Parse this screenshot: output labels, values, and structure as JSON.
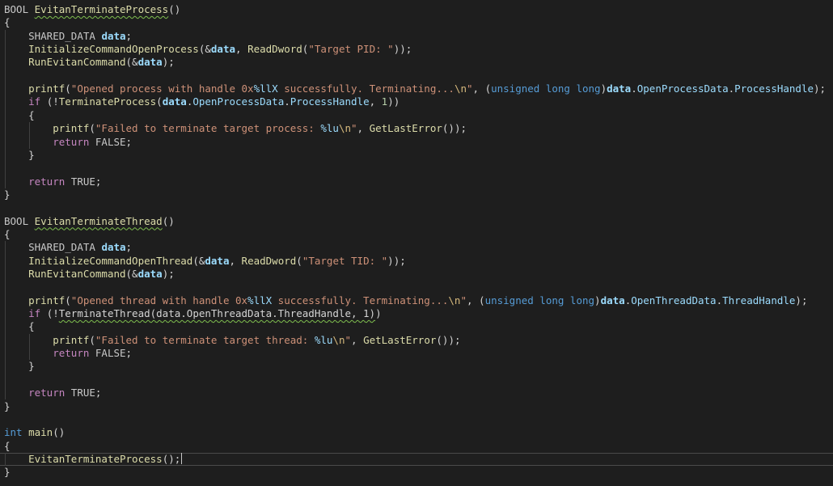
{
  "editor": {
    "lines": [
      [
        {
          "t": "BOOL",
          "c": "mac"
        },
        {
          "t": " ",
          "c": "plain"
        },
        {
          "t": "EvitanTerminateProcess",
          "c": "fn sq"
        },
        {
          "t": "()",
          "c": "plain"
        }
      ],
      [
        {
          "t": "{",
          "c": "plain"
        }
      ],
      [
        {
          "t": "    ",
          "c": "plain"
        },
        {
          "t": "SHARED_DATA",
          "c": "mac"
        },
        {
          "t": " ",
          "c": "plain"
        },
        {
          "t": "data",
          "c": "var strong"
        },
        {
          "t": ";",
          "c": "plain"
        }
      ],
      [
        {
          "t": "    ",
          "c": "plain"
        },
        {
          "t": "InitializeCommandOpenProcess",
          "c": "fn"
        },
        {
          "t": "(&",
          "c": "plain"
        },
        {
          "t": "data",
          "c": "var strong"
        },
        {
          "t": ", ",
          "c": "plain"
        },
        {
          "t": "ReadDword",
          "c": "fn"
        },
        {
          "t": "(",
          "c": "plain"
        },
        {
          "t": "\"Target PID: \"",
          "c": "str"
        },
        {
          "t": "));",
          "c": "plain"
        }
      ],
      [
        {
          "t": "    ",
          "c": "plain"
        },
        {
          "t": "RunEvitanCommand",
          "c": "fn"
        },
        {
          "t": "(&",
          "c": "plain"
        },
        {
          "t": "data",
          "c": "var strong"
        },
        {
          "t": ");",
          "c": "plain"
        }
      ],
      [],
      [
        {
          "t": "    ",
          "c": "plain"
        },
        {
          "t": "printf",
          "c": "fn"
        },
        {
          "t": "(",
          "c": "plain"
        },
        {
          "t": "\"Opened process with handle 0x",
          "c": "str"
        },
        {
          "t": "%llX",
          "c": "fmt"
        },
        {
          "t": " successfully. Terminating...",
          "c": "str"
        },
        {
          "t": "\\n",
          "c": "esc"
        },
        {
          "t": "\"",
          "c": "str"
        },
        {
          "t": ", (",
          "c": "plain"
        },
        {
          "t": "unsigned long long",
          "c": "kw"
        },
        {
          "t": ")",
          "c": "plain"
        },
        {
          "t": "data",
          "c": "var strong"
        },
        {
          "t": ".",
          "c": "plain"
        },
        {
          "t": "OpenProcessData",
          "c": "var"
        },
        {
          "t": ".",
          "c": "plain"
        },
        {
          "t": "ProcessHandle",
          "c": "var"
        },
        {
          "t": ");",
          "c": "plain"
        }
      ],
      [
        {
          "t": "    ",
          "c": "plain"
        },
        {
          "t": "if",
          "c": "ctl"
        },
        {
          "t": " (!",
          "c": "plain"
        },
        {
          "t": "TerminateProcess",
          "c": "fn"
        },
        {
          "t": "(",
          "c": "plain"
        },
        {
          "t": "data",
          "c": "var strong"
        },
        {
          "t": ".",
          "c": "plain"
        },
        {
          "t": "OpenProcessData",
          "c": "var"
        },
        {
          "t": ".",
          "c": "plain"
        },
        {
          "t": "ProcessHandle",
          "c": "var"
        },
        {
          "t": ", ",
          "c": "plain"
        },
        {
          "t": "1",
          "c": "num"
        },
        {
          "t": "))",
          "c": "plain"
        }
      ],
      [
        {
          "t": "    {",
          "c": "plain"
        }
      ],
      [
        {
          "t": "        ",
          "c": "plain"
        },
        {
          "t": "printf",
          "c": "fn"
        },
        {
          "t": "(",
          "c": "plain"
        },
        {
          "t": "\"Failed to terminate target process: ",
          "c": "str"
        },
        {
          "t": "%lu",
          "c": "fmt"
        },
        {
          "t": "\\n",
          "c": "esc"
        },
        {
          "t": "\"",
          "c": "str"
        },
        {
          "t": ", ",
          "c": "plain"
        },
        {
          "t": "GetLastError",
          "c": "fn"
        },
        {
          "t": "());",
          "c": "plain"
        }
      ],
      [
        {
          "t": "        ",
          "c": "plain"
        },
        {
          "t": "return",
          "c": "ctl"
        },
        {
          "t": " ",
          "c": "plain"
        },
        {
          "t": "FALSE",
          "c": "mac"
        },
        {
          "t": ";",
          "c": "plain"
        }
      ],
      [
        {
          "t": "    }",
          "c": "plain"
        }
      ],
      [],
      [
        {
          "t": "    ",
          "c": "plain"
        },
        {
          "t": "return",
          "c": "ctl"
        },
        {
          "t": " ",
          "c": "plain"
        },
        {
          "t": "TRUE",
          "c": "mac"
        },
        {
          "t": ";",
          "c": "plain"
        }
      ],
      [
        {
          "t": "}",
          "c": "plain"
        }
      ],
      [],
      [
        {
          "t": "BOOL",
          "c": "mac"
        },
        {
          "t": " ",
          "c": "plain"
        },
        {
          "t": "EvitanTerminateThread",
          "c": "fn sq"
        },
        {
          "t": "()",
          "c": "plain"
        }
      ],
      [
        {
          "t": "{",
          "c": "plain"
        }
      ],
      [
        {
          "t": "    ",
          "c": "plain"
        },
        {
          "t": "SHARED_DATA",
          "c": "mac"
        },
        {
          "t": " ",
          "c": "plain"
        },
        {
          "t": "data",
          "c": "var strong"
        },
        {
          "t": ";",
          "c": "plain"
        }
      ],
      [
        {
          "t": "    ",
          "c": "plain"
        },
        {
          "t": "InitializeCommandOpenThread",
          "c": "fn"
        },
        {
          "t": "(&",
          "c": "plain"
        },
        {
          "t": "data",
          "c": "var strong"
        },
        {
          "t": ", ",
          "c": "plain"
        },
        {
          "t": "ReadDword",
          "c": "fn"
        },
        {
          "t": "(",
          "c": "plain"
        },
        {
          "t": "\"Target TID: \"",
          "c": "str"
        },
        {
          "t": "));",
          "c": "plain"
        }
      ],
      [
        {
          "t": "    ",
          "c": "plain"
        },
        {
          "t": "RunEvitanCommand",
          "c": "fn"
        },
        {
          "t": "(&",
          "c": "plain"
        },
        {
          "t": "data",
          "c": "var strong"
        },
        {
          "t": ");",
          "c": "plain"
        }
      ],
      [],
      [
        {
          "t": "    ",
          "c": "plain"
        },
        {
          "t": "printf",
          "c": "fn"
        },
        {
          "t": "(",
          "c": "plain"
        },
        {
          "t": "\"Opened thread with handle 0x",
          "c": "str"
        },
        {
          "t": "%llX",
          "c": "fmt"
        },
        {
          "t": " successfully. Terminating...",
          "c": "str"
        },
        {
          "t": "\\n",
          "c": "esc"
        },
        {
          "t": "\"",
          "c": "str"
        },
        {
          "t": ", (",
          "c": "plain"
        },
        {
          "t": "unsigned long long",
          "c": "kw"
        },
        {
          "t": ")",
          "c": "plain"
        },
        {
          "t": "data",
          "c": "var strong"
        },
        {
          "t": ".",
          "c": "plain"
        },
        {
          "t": "OpenThreadData",
          "c": "var"
        },
        {
          "t": ".",
          "c": "plain"
        },
        {
          "t": "ThreadHandle",
          "c": "var"
        },
        {
          "t": ");",
          "c": "plain"
        }
      ],
      [
        {
          "t": "    ",
          "c": "plain"
        },
        {
          "t": "if",
          "c": "ctl"
        },
        {
          "t": " (!",
          "c": "plain"
        },
        {
          "t": "TerminateThread(data.OpenThreadData.ThreadHandle, 1)",
          "c": "plain sq"
        },
        {
          "t": ")",
          "c": "plain"
        }
      ],
      [
        {
          "t": "    {",
          "c": "plain"
        }
      ],
      [
        {
          "t": "        ",
          "c": "plain"
        },
        {
          "t": "printf",
          "c": "fn"
        },
        {
          "t": "(",
          "c": "plain"
        },
        {
          "t": "\"Failed to terminate target thread: ",
          "c": "str"
        },
        {
          "t": "%lu",
          "c": "fmt"
        },
        {
          "t": "\\n",
          "c": "esc"
        },
        {
          "t": "\"",
          "c": "str"
        },
        {
          "t": ", ",
          "c": "plain"
        },
        {
          "t": "GetLastError",
          "c": "fn"
        },
        {
          "t": "());",
          "c": "plain"
        }
      ],
      [
        {
          "t": "        ",
          "c": "plain"
        },
        {
          "t": "return",
          "c": "ctl"
        },
        {
          "t": " ",
          "c": "plain"
        },
        {
          "t": "FALSE",
          "c": "mac"
        },
        {
          "t": ";",
          "c": "plain"
        }
      ],
      [
        {
          "t": "    }",
          "c": "plain"
        }
      ],
      [],
      [
        {
          "t": "    ",
          "c": "plain"
        },
        {
          "t": "return",
          "c": "ctl"
        },
        {
          "t": " ",
          "c": "plain"
        },
        {
          "t": "TRUE",
          "c": "mac"
        },
        {
          "t": ";",
          "c": "plain"
        }
      ],
      [
        {
          "t": "}",
          "c": "plain"
        }
      ],
      [],
      [
        {
          "t": "int",
          "c": "kw"
        },
        {
          "t": " ",
          "c": "plain"
        },
        {
          "t": "main",
          "c": "fn"
        },
        {
          "t": "()",
          "c": "plain"
        }
      ],
      [
        {
          "t": "{",
          "c": "plain"
        }
      ],
      [
        {
          "t": "    ",
          "c": "plain"
        },
        {
          "t": "EvitanTerminateProcess",
          "c": "fn"
        },
        {
          "t": "();",
          "c": "plain"
        }
      ],
      [
        {
          "t": "}",
          "c": "plain"
        }
      ]
    ],
    "current_line": 34,
    "colors": {
      "background": "#1e1e1e",
      "keyword": "#569cd6",
      "control": "#c586c0",
      "function": "#dcdcaa",
      "variable": "#9cdcfe",
      "string": "#ce9178",
      "number": "#b5cea8",
      "escape": "#d7ba7d",
      "macro": "#c8c8c8",
      "plain": "#d4d4d4"
    }
  }
}
